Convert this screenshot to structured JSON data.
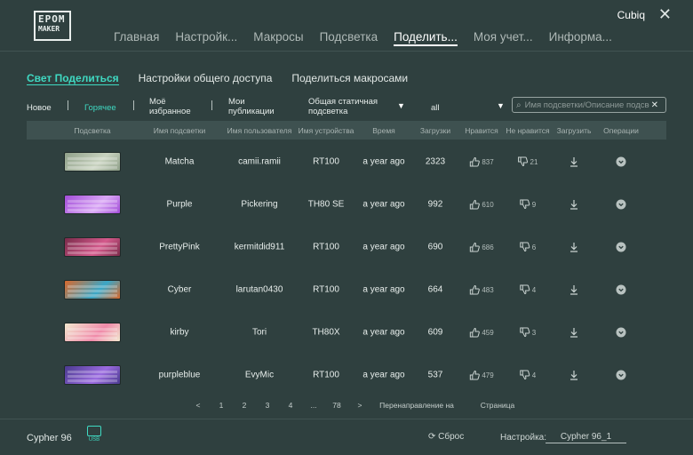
{
  "header": {
    "logo_line1": "EPOM",
    "logo_line2": "MAKER",
    "brand": "Cubiq",
    "nav": [
      "Главная",
      "Настройк...",
      "Макросы",
      "Подсветка",
      "Поделить...",
      "Моя учет...",
      "Информа..."
    ],
    "active_nav_index": 4
  },
  "subtabs": [
    "Свет Поделиться",
    "Настройки общего доступа",
    "Поделиться макросами"
  ],
  "filters": {
    "new": "Новое",
    "hot": "Горячее",
    "favorites": "Моё избранное",
    "publications": "Мои публикации",
    "type_select": "Общая статичная подсветка",
    "device_select": "all",
    "search_placeholder": "Имя подсветки/Описание подсвет"
  },
  "table": {
    "headers": [
      "Подсветка",
      "Имя подсветки",
      "Имя пользователя",
      "Имя устройства",
      "Время",
      "Загрузки",
      "Нравится",
      "Не нравится",
      "Загрузить",
      "Операции"
    ],
    "rows": [
      {
        "name": "Matcha",
        "user": "camii.ramii",
        "device": "RT100",
        "time": "a year ago",
        "downloads": "2323",
        "likes": "837",
        "dislikes": "21",
        "theme": "#8fa089",
        "theme2": "#c9d3c0"
      },
      {
        "name": "Purple",
        "user": "Pickering",
        "device": "TH80 SE",
        "time": "a year ago",
        "downloads": "992",
        "likes": "610",
        "dislikes": "9",
        "theme": "#a24dd8",
        "theme2": "#d9a7f5"
      },
      {
        "name": "PrettyPink",
        "user": "kermitdid911",
        "device": "RT100",
        "time": "a year ago",
        "downloads": "690",
        "likes": "686",
        "dislikes": "6",
        "theme": "#7a2b4a",
        "theme2": "#d45a8c"
      },
      {
        "name": "Cyber",
        "user": "larutan0430",
        "device": "RT100",
        "time": "a year ago",
        "downloads": "664",
        "likes": "483",
        "dislikes": "4",
        "theme": "#d9692c",
        "theme2": "#3aa7c7"
      },
      {
        "name": "kirby",
        "user": "Tori",
        "device": "TH80X",
        "time": "a year ago",
        "downloads": "609",
        "likes": "459",
        "dislikes": "3",
        "theme": "#f2e9d0",
        "theme2": "#f08aa9"
      },
      {
        "name": "purpleblue",
        "user": "EvyMic",
        "device": "RT100",
        "time": "a year ago",
        "downloads": "537",
        "likes": "479",
        "dislikes": "4",
        "theme": "#4a3a8f",
        "theme2": "#9b6be0"
      }
    ]
  },
  "pagination": {
    "prev": "<",
    "pages": [
      "1",
      "2",
      "3",
      "4",
      "...",
      "78"
    ],
    "next": ">",
    "redirect_label": "Перенаправление на",
    "page_label": "Страница"
  },
  "footer": {
    "device": "Cypher 96",
    "usb": "USB",
    "reset": "Сброс",
    "settings_label": "Настройка:",
    "settings_value": "Cypher 96_1"
  },
  "colors": {
    "accent": "#3fd9c2",
    "background": "#2f403f"
  }
}
